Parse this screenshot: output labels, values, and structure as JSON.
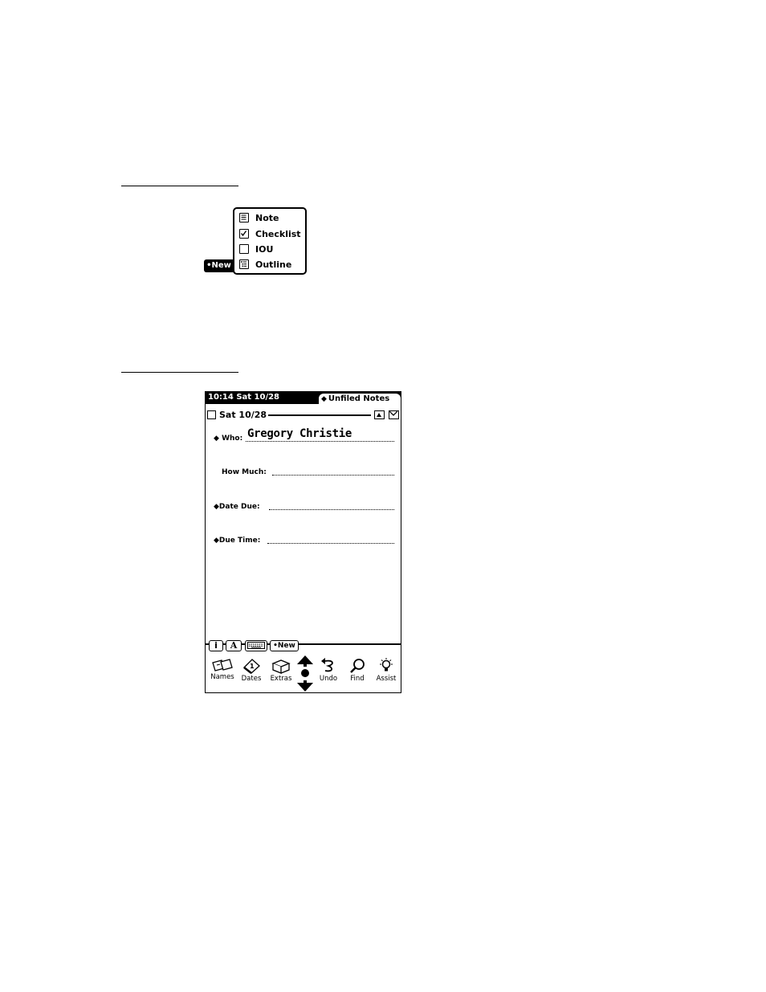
{
  "new_menu": {
    "button_label": "•New",
    "items": [
      {
        "label": "Note",
        "icon": "note-icon"
      },
      {
        "label": "Checklist",
        "icon": "checklist-icon"
      },
      {
        "label": "IOU",
        "icon": "iou-icon"
      },
      {
        "label": "Outline",
        "icon": "outline-icon"
      }
    ]
  },
  "status_bar": {
    "time": "10:14 Sat 10/28",
    "folder": "Unfiled Notes"
  },
  "note": {
    "date": "Sat 10/28",
    "fields": {
      "who_label": "Who:",
      "who_value": "Gregory Christie",
      "how_much_label": "How Much:",
      "date_due_label": "Date Due:",
      "due_time_label": "Due Time:"
    }
  },
  "tabs": {
    "info": "i",
    "style": "A",
    "new": "•New"
  },
  "toolbar": {
    "names": "Names",
    "dates": "Dates",
    "extras": "Extras",
    "undo": "Undo",
    "find": "Find",
    "assist": "Assist"
  }
}
